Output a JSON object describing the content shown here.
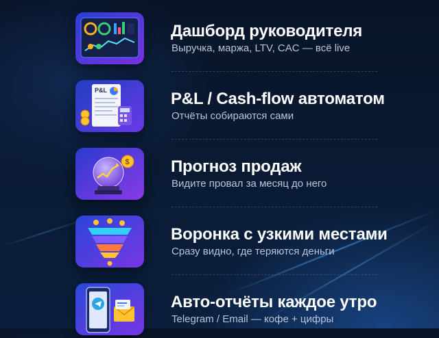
{
  "features": [
    {
      "title": "Дашборд руководителя",
      "subtitle": "Выручка, маржа, LTV, CAC — всё live",
      "icon": "dashboard-icon",
      "tile_colors": [
        "#2a3fd6",
        "#7b2fe0"
      ]
    },
    {
      "title": "P&L / Cash-flow автоматом",
      "subtitle": "Отчёты собираются сами",
      "icon": "pnl-report-icon",
      "tile_colors": [
        "#1f3fc0",
        "#6a38e8"
      ],
      "icon_label": "P&L"
    },
    {
      "title": "Прогноз продаж",
      "subtitle": "Видите провал за месяц до него",
      "icon": "crystal-ball-icon",
      "tile_colors": [
        "#2a3ad0",
        "#8a3ae6"
      ]
    },
    {
      "title": "Воронка с узкими местами",
      "subtitle": "Сразу видно, где теряются деньги",
      "icon": "sales-funnel-icon",
      "tile_colors": [
        "#2845d8",
        "#7a36e4"
      ]
    },
    {
      "title": "Авто-отчёты каждое утро",
      "subtitle": "Telegram / Email — кофе + цифры",
      "icon": "telegram-email-icon",
      "tile_colors": [
        "#2a48da",
        "#7636e2"
      ]
    }
  ]
}
